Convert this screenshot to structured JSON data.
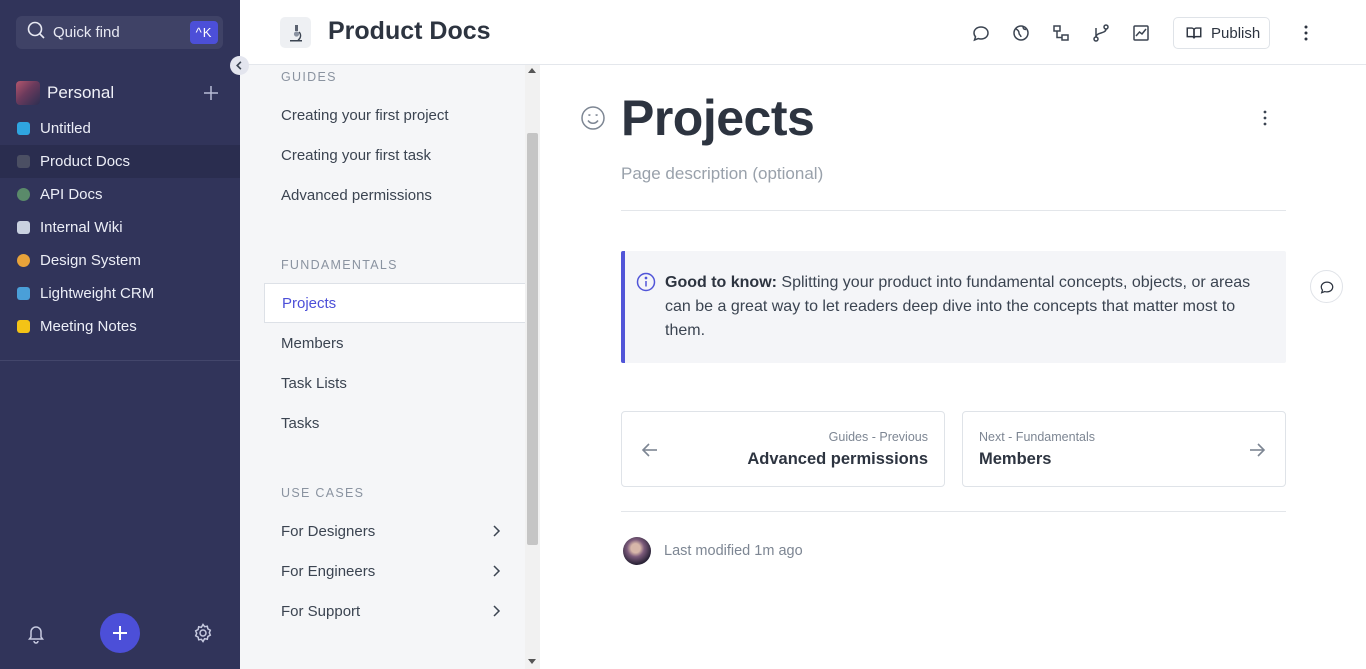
{
  "nav": {
    "quick_find_label": "Quick find",
    "quick_find_shortcut": "^K",
    "workspace_name": "Personal",
    "spaces": [
      {
        "label": "Untitled",
        "color": "#2fa5e0"
      },
      {
        "label": "Product Docs",
        "color": "#6b7280"
      },
      {
        "label": "API Docs",
        "color": "#5a8a6a"
      },
      {
        "label": "Internal Wiki",
        "color": "#c9d1e0"
      },
      {
        "label": "Design System",
        "color": "#e8a33a"
      },
      {
        "label": "Lightweight CRM",
        "color": "#4a9fd8"
      },
      {
        "label": "Meeting Notes",
        "color": "#f3c316"
      }
    ],
    "active_space": "Product Docs",
    "accent_color": "#4c4fd8"
  },
  "header": {
    "space_title": "Product Docs",
    "publish_label": "Publish"
  },
  "tree": {
    "sections": [
      {
        "heading": "GUIDES",
        "items": [
          "Creating your first project",
          "Creating your first task",
          "Advanced permissions"
        ]
      },
      {
        "heading": "FUNDAMENTALS",
        "items": [
          "Projects",
          "Members",
          "Task Lists",
          "Tasks"
        ]
      },
      {
        "heading": "USE CASES",
        "items": [
          "For Designers",
          "For Engineers",
          "For Support"
        ]
      }
    ],
    "active_item": "Projects"
  },
  "page": {
    "title": "Projects",
    "description_placeholder": "Page description (optional)",
    "hint_bold": "Good to know:",
    "hint_text": " Splitting your product into fundamental concepts, objects, or areas can be a great way to let readers deep dive into the concepts that matter most to them.",
    "prev": {
      "sub": "Guides - Previous",
      "title": "Advanced permissions"
    },
    "next": {
      "sub": "Next - Fundamentals",
      "title": "Members"
    },
    "last_modified": "Last modified 1m ago"
  }
}
